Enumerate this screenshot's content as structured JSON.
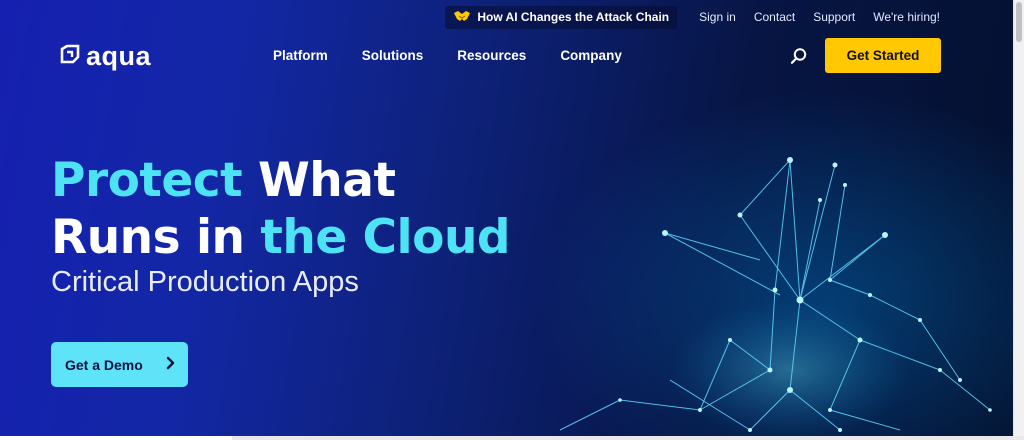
{
  "utility_bar": {
    "promo": "How AI Changes the Attack Chain",
    "links": [
      "Sign in",
      "Contact",
      "Support",
      "We're hiring!"
    ]
  },
  "brand": {
    "name": "aqua"
  },
  "nav": {
    "items": [
      "Platform",
      "Solutions",
      "Resources",
      "Company"
    ]
  },
  "header": {
    "cta_label": "Get Started"
  },
  "hero": {
    "title_part1": "Protect",
    "title_part2": " What",
    "title_part3": "Runs in ",
    "title_part4": "the Cloud",
    "subtitle": "Critical Production Apps",
    "demo_label": "Get a Demo"
  },
  "icons": {
    "promo": "handshake-icon",
    "search": "search-icon",
    "demo": "chevron-right-icon",
    "logo": "aqua-logo-mark"
  },
  "colors": {
    "accent": "#4de3f5",
    "cta": "#ffc800",
    "demo_button": "#5fe3f8",
    "background_start": "#1520b0",
    "background_end": "#04102e"
  }
}
